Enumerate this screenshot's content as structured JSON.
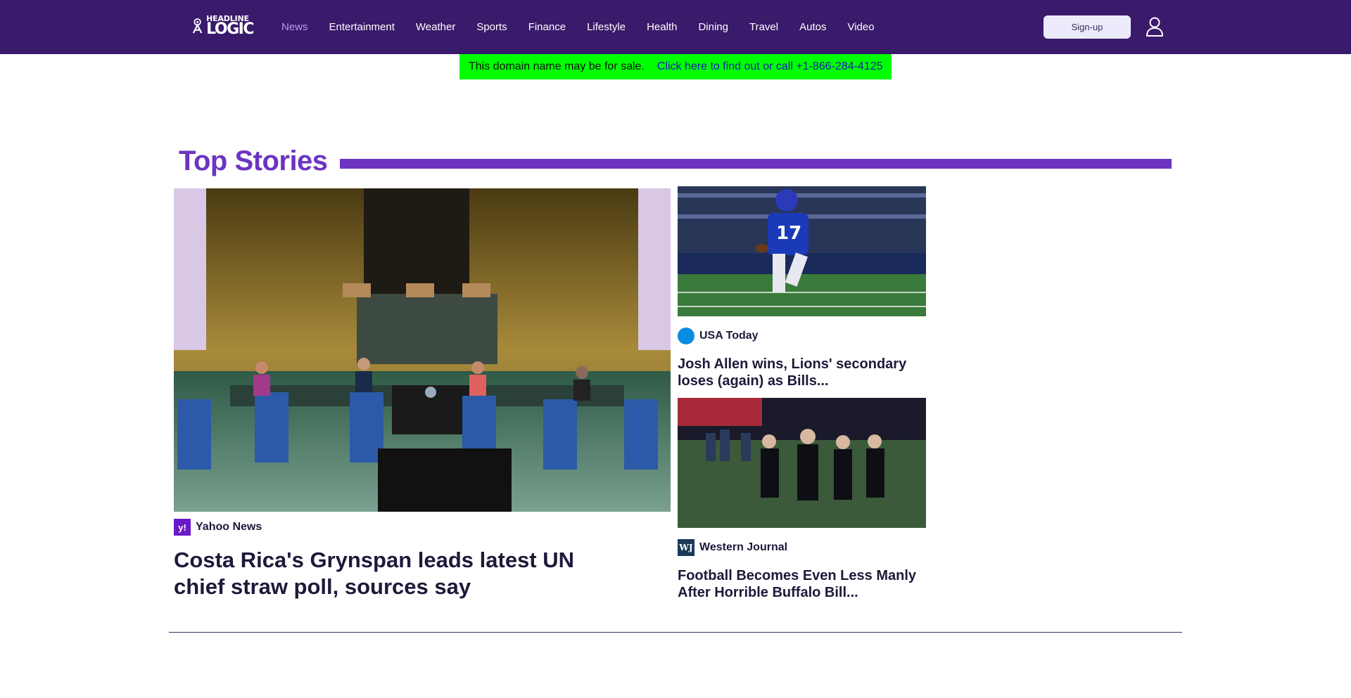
{
  "header": {
    "logo_top": "HEADLINE",
    "logo_bottom": "LOGIC",
    "nav": [
      {
        "label": "News",
        "active": true
      },
      {
        "label": "Entertainment"
      },
      {
        "label": "Weather"
      },
      {
        "label": "Sports"
      },
      {
        "label": "Finance"
      },
      {
        "label": "Lifestyle"
      },
      {
        "label": "Health"
      },
      {
        "label": "Dining"
      },
      {
        "label": "Travel"
      },
      {
        "label": "Autos"
      },
      {
        "label": "Video"
      }
    ],
    "signup_label": "Sign-up",
    "user_icon": "user-icon"
  },
  "sale_banner": {
    "text": "This domain name may be for sale.",
    "link": "Click here to find out or call +1-866-284-4125"
  },
  "top_stories": {
    "title": "Top Stories",
    "main": {
      "source": "Yahoo News",
      "source_logo": "y!",
      "headline": "Costa Rica's Grynspan leads latest UN chief straw poll, sources say"
    },
    "side": [
      {
        "source": "USA Today",
        "headline": "Josh Allen wins, Lions' secondary loses (again) as Bills..."
      },
      {
        "source": "Western Journal",
        "source_logo": "WJ",
        "headline": "Football Becomes Even Less Manly After Horrible Buffalo Bill..."
      }
    ]
  },
  "colors": {
    "header_bg": "#3a1a6b",
    "accent": "#6c34c1",
    "sale_bg": "#00ff00",
    "nav_active": "#b49bf0"
  }
}
